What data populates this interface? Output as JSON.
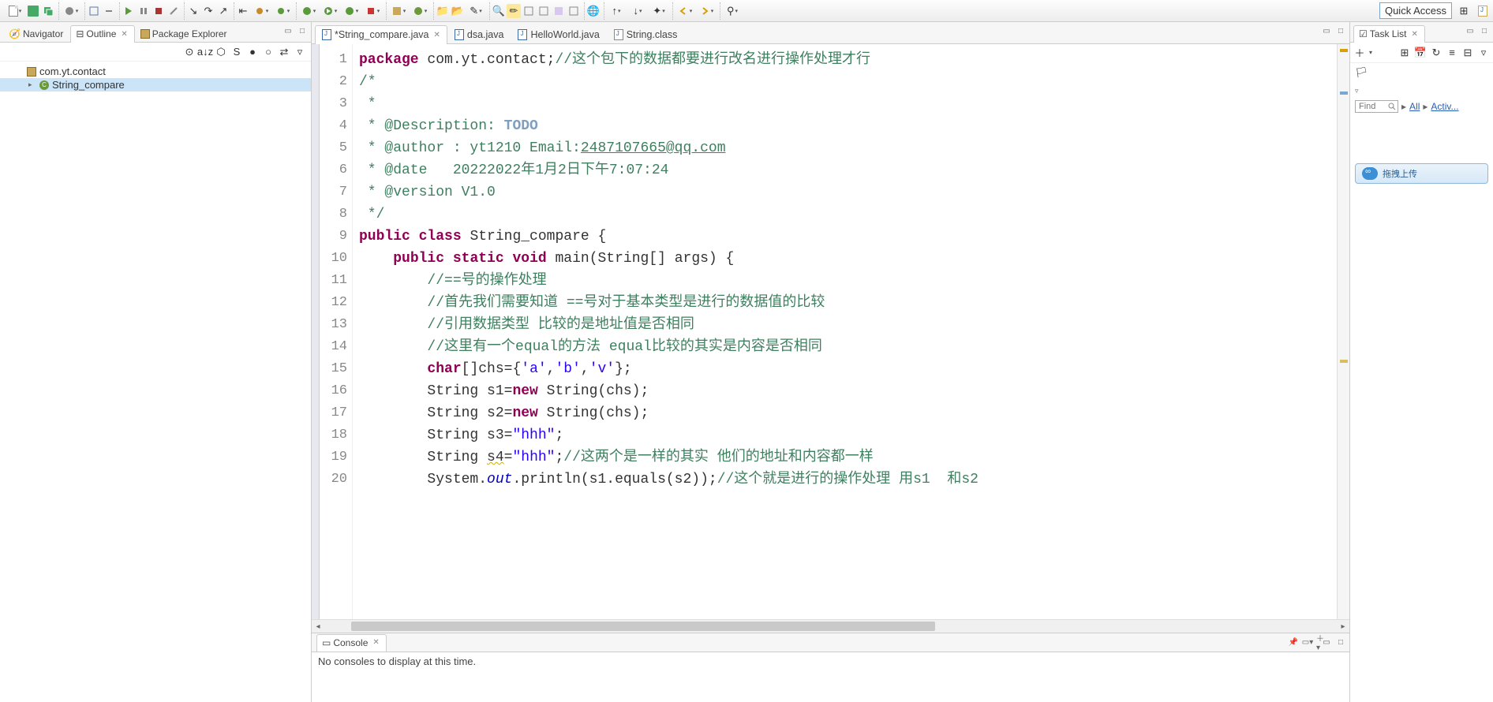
{
  "quick_access": "Quick Access",
  "left": {
    "tabs": [
      "Navigator",
      "Outline",
      "Package Explorer"
    ],
    "active_tab": 1,
    "tree": {
      "root": {
        "label": "com.yt.contact"
      },
      "child": {
        "label": "String_compare"
      }
    }
  },
  "editor": {
    "tabs": [
      {
        "label": "*String_compare.java",
        "active": true,
        "closable": true
      },
      {
        "label": "dsa.java",
        "active": false,
        "closable": false
      },
      {
        "label": "HelloWorld.java",
        "active": false,
        "closable": false
      },
      {
        "label": "String.class",
        "active": false,
        "closable": false
      }
    ],
    "code": {
      "l1_kw": "package",
      "l1_rest": " com.yt.contact;",
      "l1_com": "//这个包下的数据都要进行改名进行操作处理才行",
      "l2": "/*",
      "l3": " *",
      "l4a": " * @Description: ",
      "l4b": "TODO",
      "l5a": " * @author : yt1210 Email:",
      "l5b": "2487107665@qq.com",
      "l6": " * @date   20222022年1月2日下午7:07:24",
      "l7": " * @version V1.0",
      "l8": " */",
      "l9_kw1": "public",
      "l9_kw2": "class",
      "l9_rest": " String_compare {",
      "l10_kw1": "public",
      "l10_kw2": "static",
      "l10_kw3": "void",
      "l10_rest": " main(String[] args) {",
      "l11": "//==号的操作处理",
      "l12": "//首先我们需要知道 ==号对于基本类型是进行的数据值的比较",
      "l13": "//引用数据类型 比较的是地址值是否相同",
      "l14": "//这里有一个equal的方法 equal比较的其实是内容是否相同",
      "l15_kw": "char",
      "l15_mid": "[]chs={",
      "l15_s1": "'a'",
      "l15_c1": ",",
      "l15_s2": "'b'",
      "l15_c2": ",",
      "l15_s3": "'v'",
      "l15_end": "};",
      "l16a": "String s1=",
      "l16_kw": "new",
      "l16b": " String(chs);",
      "l17a": "String s2=",
      "l17_kw": "new",
      "l17b": " String(chs);",
      "l18a": "String s3=",
      "l18_s": "\"hhh\"",
      "l18b": ";",
      "l19a": "String ",
      "l19_v": "s4",
      "l19b": "=",
      "l19_s": "\"hhh\"",
      "l19c": ";",
      "l19_com": "//这两个是一样的其实 他们的地址和内容都一样",
      "l20a": "System.",
      "l20_f": "out",
      "l20b": ".println(s1.equals(s2));",
      "l20_com": "//这个就是进行的操作处理 用s1  和s2"
    }
  },
  "console": {
    "title": "Console",
    "message": "No consoles to display at this time."
  },
  "tasks": {
    "title": "Task List",
    "find_placeholder": "Find",
    "filter_all": "All",
    "filter_activ": "Activ...",
    "cloud_label": "拖拽上传"
  }
}
